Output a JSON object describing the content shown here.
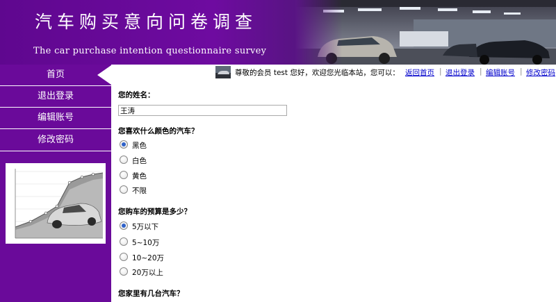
{
  "header": {
    "title_cn": "汽车购买意向问卷调查",
    "title_en": "The car purchase intention questionnaire survey"
  },
  "sidebar": {
    "items": [
      {
        "label": "首页"
      },
      {
        "label": "退出登录"
      },
      {
        "label": "编辑账号"
      },
      {
        "label": "修改密码"
      }
    ]
  },
  "topbar": {
    "welcome": "尊敬的会员 test 您好，欢迎您光临本站，您可以：",
    "links": [
      {
        "label": "返回首页"
      },
      {
        "label": "退出登录"
      },
      {
        "label": "编辑账号"
      },
      {
        "label": "修改密码"
      }
    ]
  },
  "form": {
    "q_name": {
      "title": "您的姓名：",
      "value": "王涛"
    },
    "q_color": {
      "title": "您喜欢什么颜色的汽车？",
      "options": [
        {
          "label": "黑色",
          "checked": true
        },
        {
          "label": "白色",
          "checked": false
        },
        {
          "label": "黄色",
          "checked": false
        },
        {
          "label": "不限",
          "checked": false
        }
      ]
    },
    "q_budget": {
      "title": "您购车的预算是多少？",
      "options": [
        {
          "label": "5万以下",
          "checked": true
        },
        {
          "label": "5~10万",
          "checked": false
        },
        {
          "label": "10~20万",
          "checked": false
        },
        {
          "label": "20万以上",
          "checked": false
        }
      ]
    },
    "q_count": {
      "title": "您家里有几台汽车？"
    }
  },
  "colors": {
    "brand_purple": "#6a0a9a",
    "link_blue": "#0000cc",
    "radio_checked": "#2f62c9"
  }
}
